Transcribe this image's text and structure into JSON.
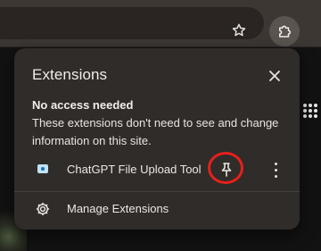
{
  "browser": {
    "star_icon": "star-outline-icon",
    "extensions_icon": "puzzle-piece-icon"
  },
  "popup": {
    "title": "Extensions",
    "close_icon": "close-icon",
    "section": {
      "heading": "No access needed",
      "description": "These extensions don't need to see and change information on this site."
    },
    "extensions": [
      {
        "name": "ChatGPT File Upload Tool",
        "icon": "extension-favicon-icon",
        "pin_icon": "pin-icon",
        "pin_highlight_color": "#e6201b",
        "more_icon": "more-vertical-icon"
      }
    ],
    "manage": {
      "label": "Manage Extensions",
      "icon": "gear-icon"
    }
  },
  "colors": {
    "popup_bg": "#2f2c29",
    "toolbar_bg": "#3c3733",
    "highlight": "#e6201b"
  }
}
